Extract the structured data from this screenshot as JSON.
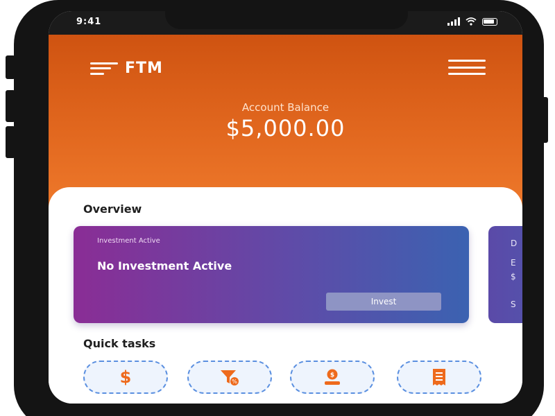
{
  "status_bar": {
    "time": "9:41"
  },
  "header": {
    "logo_text": "FTM",
    "balance_label": "Account Balance",
    "balance_value": "$5,000.00"
  },
  "overview": {
    "title": "Overview",
    "investment_card": {
      "kicker": "Investment Active",
      "headline": "No Investment Active",
      "button_label": "Invest"
    },
    "next_card_partial_lines": [
      "D",
      "E",
      "$",
      "S"
    ]
  },
  "quick_tasks": {
    "title": "Quick tasks",
    "items": [
      {
        "icon": "dollar-icon",
        "glyph": "$"
      },
      {
        "icon": "filter-percent-icon",
        "glyph": ""
      },
      {
        "icon": "coin-hand-icon",
        "glyph": ""
      },
      {
        "icon": "receipt-icon",
        "glyph": ""
      }
    ]
  },
  "colors": {
    "header_orange": "#e2681f",
    "accent_orange": "#ee6a1c",
    "card_purple": "#8a2d95",
    "card_blue": "#3b62b1",
    "task_border_blue": "#5a8fe0"
  }
}
